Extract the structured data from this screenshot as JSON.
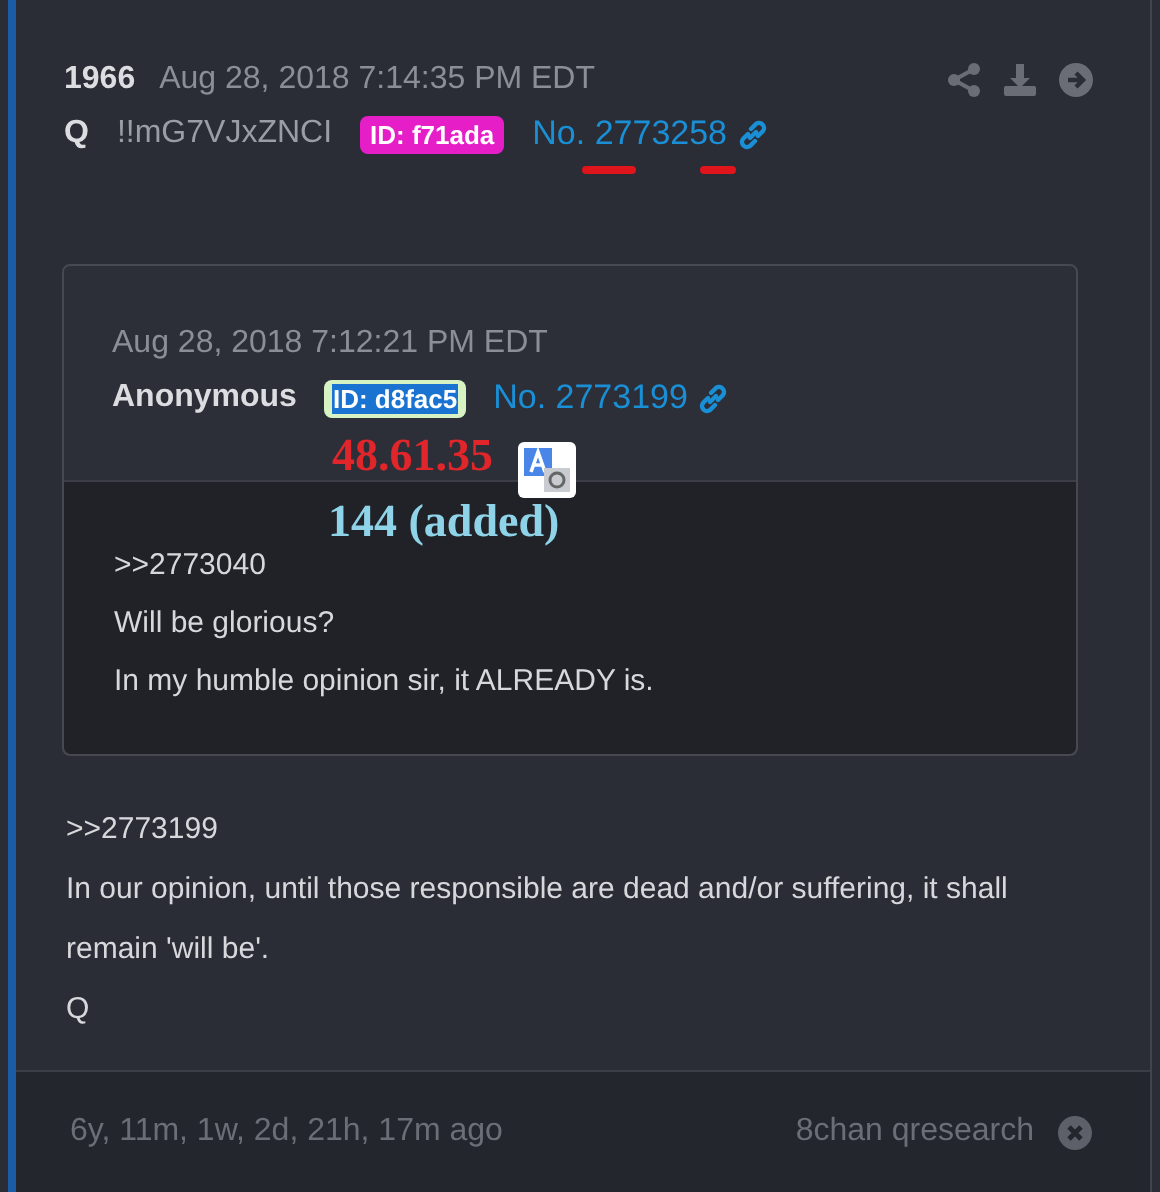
{
  "post": {
    "number": "1966",
    "date": "Aug 28, 2018 7:14:35 PM EDT",
    "name": "Q",
    "tripcode": "!!mG7VJxZNCI",
    "id_badge": "ID: f71ada",
    "post_link": "No. 2773258"
  },
  "quoted_post": {
    "date": "Aug 28, 2018 7:12:21 PM EDT",
    "name": "Anonymous",
    "id_badge": "ID: d8fac5",
    "post_link": "No. 2773199",
    "lines": [
      ">>2773040",
      "Will be glorious?",
      "In my humble opinion sir, it ALREADY is."
    ]
  },
  "annotations": [
    {
      "text": "48.61.35",
      "color": "#e0262b"
    },
    {
      "text": "144 (added)",
      "color": "#8fd3e8"
    }
  ],
  "body_lines": [
    ">>2773199",
    "In our opinion, until those responsible are dead and/or suffering, it shall remain 'will be'.",
    "Q"
  ],
  "footer": {
    "age": "6y, 11m, 1w, 2d, 21h, 17m ago",
    "source": "8chan qresearch"
  }
}
